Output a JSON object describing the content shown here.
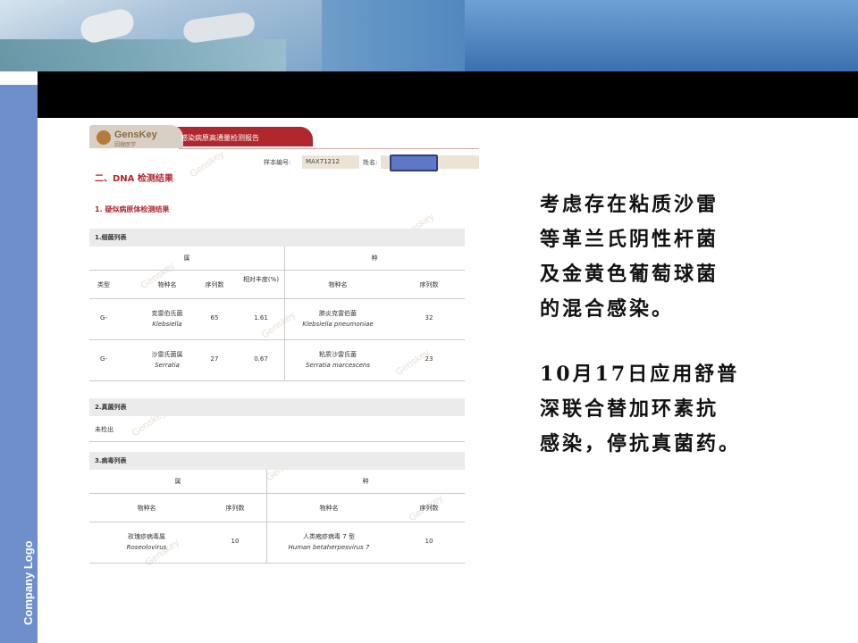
{
  "sidebar": {
    "logo_text": "Company Logo"
  },
  "report": {
    "brand": "GensKey",
    "brand_cn": "因微医学",
    "title": "感染病原高通量检测报告",
    "sample_label": "样本编号:",
    "sample_value": "MAX71212",
    "name_label": "姓名:",
    "watermark": "Genskey",
    "section_title": "二、DNA 检测结果",
    "subsection_title": "1. 疑似病原体检测结果",
    "bacteria": {
      "heading": "1.细菌列表",
      "genus_header": "属",
      "species_header": "种",
      "columns": [
        "类型",
        "物种名",
        "序列数",
        "相对丰度(%)",
        "物种名",
        "序列数"
      ],
      "rows": [
        {
          "type": "G-",
          "genus_cn": "克雷伯氏菌",
          "genus_latin": "Klebsiella",
          "genus_reads": "65",
          "abundance": "1.61",
          "species_cn": "肺炎克雷伯菌",
          "species_latin": "Klebsiella pneumoniae",
          "species_reads": "32"
        },
        {
          "type": "G-",
          "genus_cn": "沙雷氏菌属",
          "genus_latin": "Serratia",
          "genus_reads": "27",
          "abundance": "0.67",
          "species_cn": "粘质沙雷氏菌",
          "species_latin": "Serratia marcescens",
          "species_reads": "23"
        }
      ]
    },
    "fungi": {
      "heading": "2.真菌列表",
      "result": "未检出"
    },
    "virus": {
      "heading": "3.病毒列表",
      "genus_header": "属",
      "species_header": "种",
      "columns": [
        "物种名",
        "序列数",
        "物种名",
        "序列数"
      ],
      "rows": [
        {
          "genus_cn": "玫瑰疹病毒属",
          "genus_latin": "Roseolovirus",
          "genus_reads": "10",
          "species_cn": "人类疱疹病毒 7 型",
          "species_latin": "Human betaherpesvirus 7",
          "species_reads": "10"
        }
      ]
    }
  },
  "notes": {
    "line1": "考虑存在粘质沙雷",
    "line2": "等革兰氏阴性杆菌",
    "line3": "及金黄色葡萄球菌",
    "line4": "的混合感染。",
    "line5": "10月17日应用舒普",
    "line6": "深联合替加环素抗",
    "line7": "感染，停抗真菌药。"
  }
}
